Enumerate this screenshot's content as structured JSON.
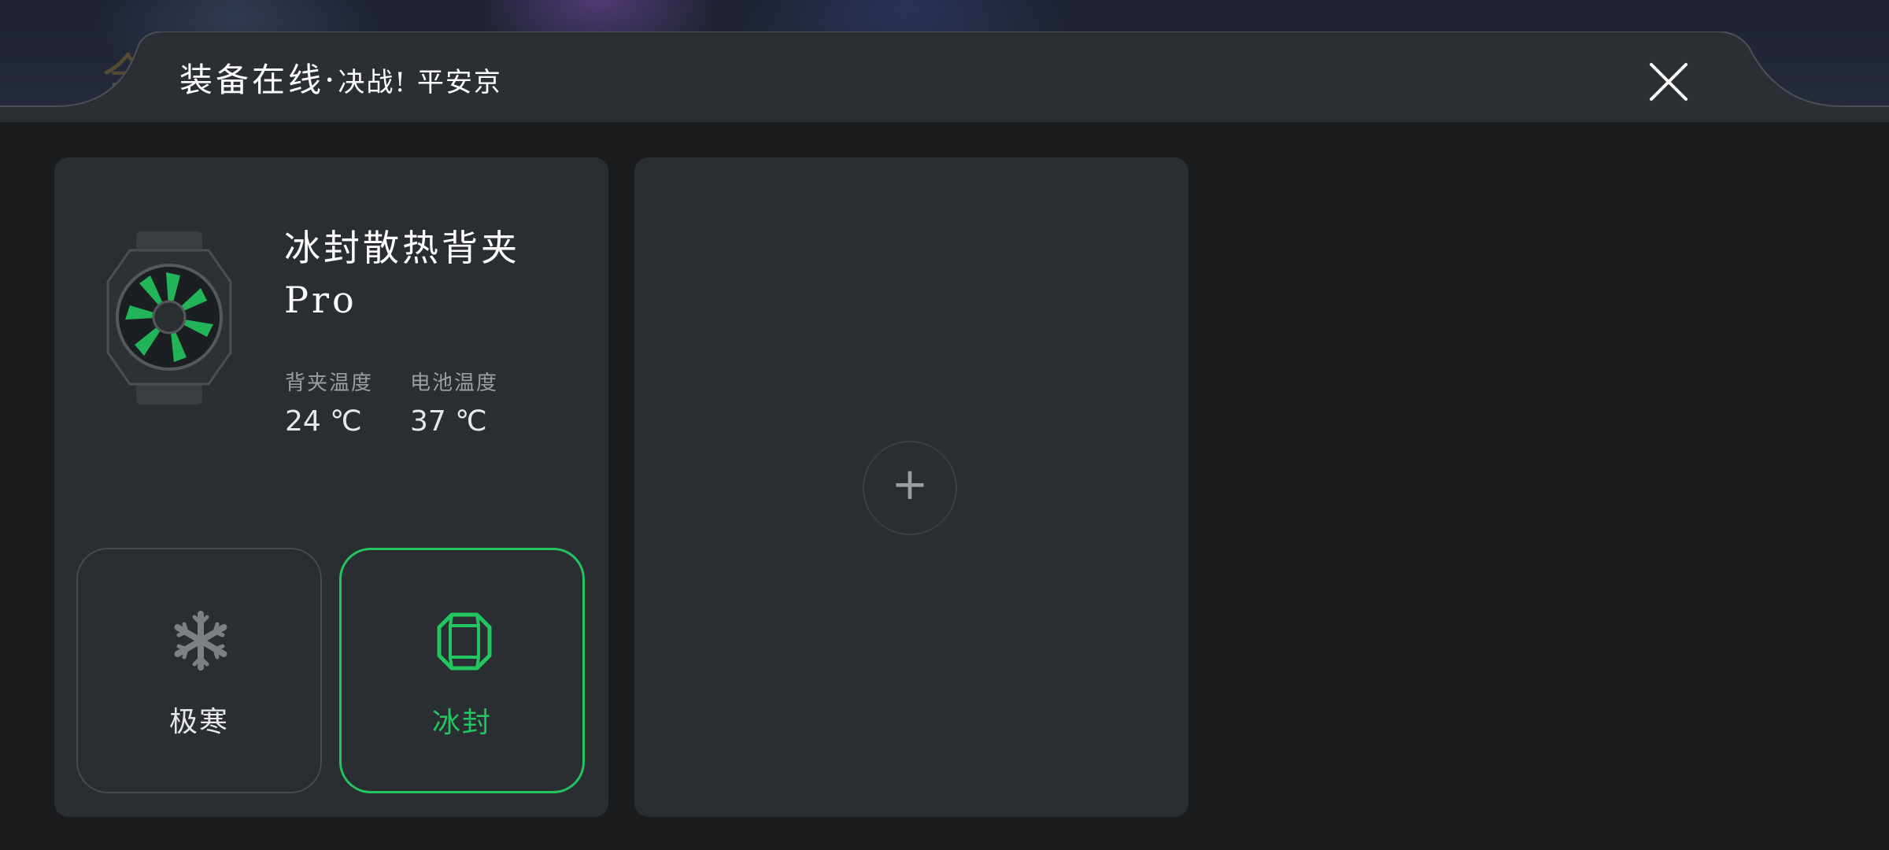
{
  "header": {
    "title": "装备在线",
    "separator": "·",
    "subtitle": "决战! 平安京",
    "bg_glyph": "全"
  },
  "device": {
    "name": "冰封散热背夹Pro",
    "image_icon": "cooling-fan-clip-image",
    "stats": [
      {
        "label": "背夹温度",
        "value": "24 ℃"
      },
      {
        "label": "电池温度",
        "value": "37 ℃"
      }
    ],
    "modes": [
      {
        "label": "极寒",
        "icon": "snowflake-icon",
        "selected": false
      },
      {
        "label": "冰封",
        "icon": "octagon-frame-icon",
        "selected": true
      }
    ]
  },
  "add_slot": {
    "icon": "+"
  },
  "colors": {
    "background": "#1a1c1e",
    "card": "#2a2e32",
    "accent": "#22c55e",
    "muted_text": "#9a9ea3"
  }
}
